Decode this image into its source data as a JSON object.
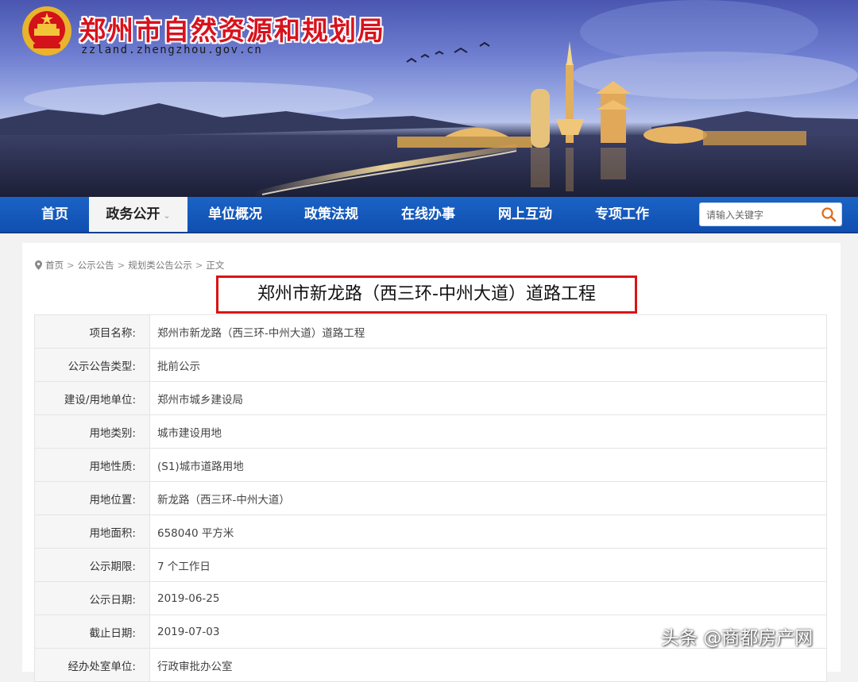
{
  "header": {
    "title": "郑州市自然资源和规划局",
    "domain": "zzland.zhengzhou.gov.cn",
    "emblem_icon": "national-emblem-icon",
    "title_color": "#d8121d"
  },
  "nav": {
    "items": [
      {
        "label": "首页"
      },
      {
        "label": "政务公开",
        "active": true
      },
      {
        "label": "单位概况"
      },
      {
        "label": "政策法规"
      },
      {
        "label": "在线办事"
      },
      {
        "label": "网上互动"
      },
      {
        "label": "专项工作"
      }
    ],
    "search_placeholder": "请输入关键字",
    "search_icon": "search-icon",
    "bar_color": "#1b63c6"
  },
  "breadcrumb": {
    "items": [
      "首页",
      "公示公告",
      "规划类公告公示",
      "正文"
    ],
    "separator": ">"
  },
  "article": {
    "title": "郑州市新龙路（西三环-中州大道）道路工程",
    "highlight_color": "#d91515"
  },
  "info_table": {
    "rows": [
      {
        "label": "项目名称:",
        "value": "郑州市新龙路（西三环-中州大道）道路工程"
      },
      {
        "label": "公示公告类型:",
        "value": "批前公示"
      },
      {
        "label": "建设/用地单位:",
        "value": "郑州市城乡建设局"
      },
      {
        "label": "用地类别:",
        "value": "城市建设用地"
      },
      {
        "label": "用地性质:",
        "value": "(S1)城市道路用地"
      },
      {
        "label": "用地位置:",
        "value": "新龙路（西三环-中州大道）"
      },
      {
        "label": "用地面积:",
        "value": "658040 平方米"
      },
      {
        "label": "公示期限:",
        "value": "7 个工作日"
      },
      {
        "label": "公示日期:",
        "value": "2019-06-25"
      },
      {
        "label": "截止日期:",
        "value": "2019-07-03"
      },
      {
        "label": "经办处室单位:",
        "value": "行政审批办公室"
      }
    ]
  },
  "watermark": "头条 @商都房产网"
}
